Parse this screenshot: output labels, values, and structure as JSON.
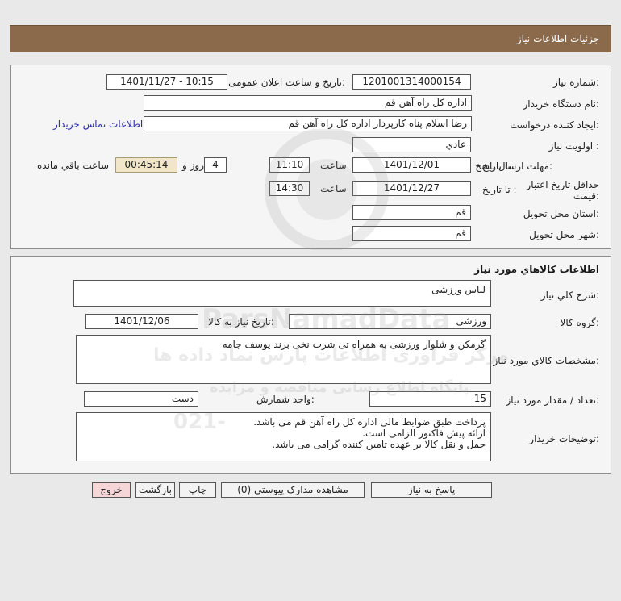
{
  "header": {
    "title": "جزئيات اطلاعات نياز"
  },
  "need_info": {
    "need_number_label": "شماره نياز:",
    "need_number": "1201001314000154",
    "announce_label": "تاريخ و ساعت اعلان عمومی:",
    "announce_value": "1401/11/27 - 10:15",
    "buyer_org_label": "نام دستگاه خريدار:",
    "buyer_org": "اداره کل  راه آهن قم",
    "requester_label": "ايجاد کننده درخواست:",
    "requester": "رضا اسلام پناه کارپرداز اداره کل  راه آهن قم",
    "contact_link": "اطلاعات تماس خريدار",
    "priority_label": "اولويت نياز :",
    "priority": "عادي",
    "reply_deadline_label": "مهلت ارسال پاسخ:",
    "until_date_label": "تا تاريخ :",
    "reply_date": "1401/12/01",
    "time_label": "ساعت",
    "reply_time": "11:10",
    "days_value": "4",
    "days_label": "روز و",
    "remaining_time": "00:45:14",
    "remaining_label": "ساعت باقي مانده",
    "validity_label_1": "حداقل تاريخ اعتبار",
    "validity_label_2": "قيمت:",
    "validity_date": "1401/12/27",
    "validity_time": "14:30",
    "province_label": "استان محل تحويل:",
    "province": "قم",
    "city_label": "شهر محل تحويل:",
    "city": "قم"
  },
  "goods_info": {
    "section_title": "اطلاعات کالاهاي مورد نياز",
    "summary_label": "شرح کلي نياز:",
    "summary": "لباس ورزشی",
    "group_label": "گروه کالا:",
    "group": "ورزشی",
    "need_date_label": "تاريخ نياز به کالا:",
    "need_date": "1401/12/06",
    "specs_label": "مشخصات کالاي مورد نياز:",
    "specs": "گرمکن و شلوار ورزشی به همراه تی شرت نخی برند یوسف جامه",
    "quantity_label": "تعداد / مقدار مورد نياز:",
    "quantity": "15",
    "unit_label": "واحد شمارش:",
    "unit": "دست",
    "buyer_notes_label": "توضيحات خريدار:",
    "buyer_notes": [
      "پرداخت طبق ضوابط مالی اداره کل راه آهن قم می باشد.",
      "ارائه پیش فاکتور الزامی است.",
      "حمل و نقل کالا بر عهده تامین کننده گرامی می باشد."
    ]
  },
  "buttons": {
    "reply": "پاسخ به نياز",
    "attachments": "مشاهده مدارک پيوستي (0)",
    "print": "چاپ",
    "back": "بازگشت",
    "exit": "خروج"
  },
  "watermark": {
    "brand": "ParsNamadData",
    "line1": "مرکز فراوری اطلاعات پارس نماد داده ها",
    "line2": "پایگاه اطلاع رسانی مناقصه و مزایده",
    "phone": "021-"
  },
  "colors": {
    "header_bg": "#8a6a4b",
    "panel_bg": "#f5f5f5",
    "remaining_bg": "#f1e6c9",
    "exit_bg": "#f6d6d6",
    "link": "#2c2ca8"
  }
}
